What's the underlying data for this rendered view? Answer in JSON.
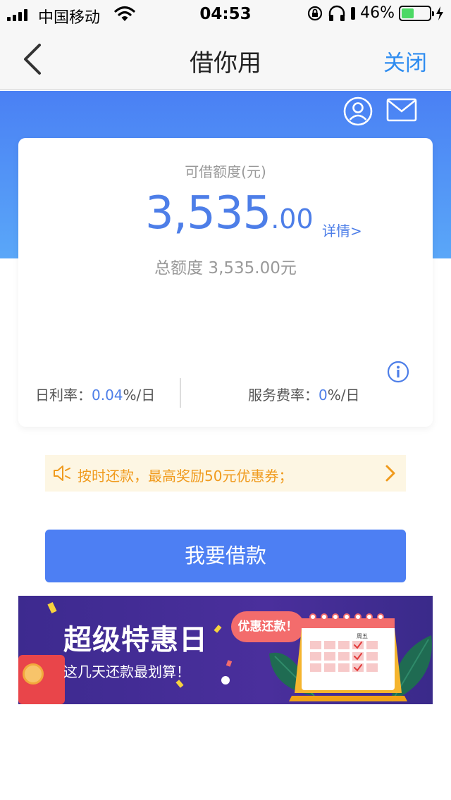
{
  "status_bar": {
    "carrier": "中国移动",
    "time": "04:53",
    "battery": "46%",
    "battery_level": 0.46
  },
  "nav": {
    "back_icon": "chevron-left-icon",
    "title": "借你用",
    "close_label": "关闭"
  },
  "header_icons": [
    "user-icon",
    "mail-icon"
  ],
  "card": {
    "label": "可借额度(元)",
    "amount_integer": "3,535",
    "amount_decimal": ".00",
    "detail_link": "详情>",
    "total_label": "总额度 3,535.00元",
    "daily_rate_label": "日利率：",
    "daily_rate_value": "0.04",
    "daily_rate_unit": "%/日",
    "service_fee_label": "服务费率：",
    "service_fee_value": "0",
    "service_fee_unit": "%/日"
  },
  "notice": {
    "text": "按时还款，最高奖励50元优惠券；"
  },
  "loan_button": "我要借款",
  "banner": {
    "title": "超级特惠日",
    "subtitle": "这几天还款最划算！",
    "bubble": "优惠还款！",
    "calendar_day": "周五"
  },
  "colors": {
    "accent": "#4d7ff3",
    "link": "#2e8cf0",
    "notice_text": "#f09a1c",
    "banner_bg": "#3d2a8f"
  }
}
